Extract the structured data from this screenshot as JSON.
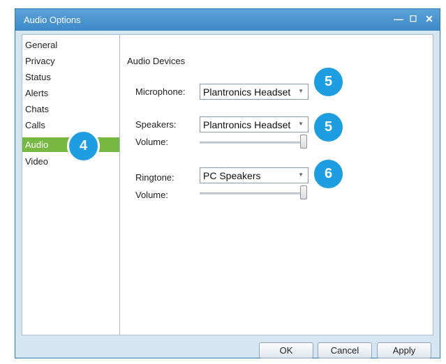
{
  "window": {
    "title": "Audio Options",
    "minimize_glyph": "—",
    "maximize_glyph": "☐",
    "close_glyph": "✕"
  },
  "sidebar": {
    "items": [
      {
        "label": "General"
      },
      {
        "label": "Privacy"
      },
      {
        "label": "Status"
      },
      {
        "label": "Alerts"
      },
      {
        "label": "Chats"
      },
      {
        "label": "Calls"
      },
      {
        "label": "Audio",
        "selected": true
      },
      {
        "label": "Video"
      }
    ]
  },
  "content": {
    "section_title": "Audio Devices",
    "microphone": {
      "label": "Microphone:",
      "value": "Plantronics Headset"
    },
    "speakers": {
      "label": "Speakers:",
      "value": "Plantronics Headset",
      "volume_label": "Volume:",
      "volume_fraction": 1.0
    },
    "ringtone": {
      "label": "Ringtone:",
      "value": "PC Speakers",
      "volume_label": "Volume:",
      "volume_fraction": 1.0
    }
  },
  "badges": [
    {
      "id": "audio-tab",
      "number": "4"
    },
    {
      "id": "microphone",
      "number": "5"
    },
    {
      "id": "speakers",
      "number": "5"
    },
    {
      "id": "ringtone",
      "number": "6"
    }
  ],
  "buttons": {
    "ok": "OK",
    "cancel": "Cancel",
    "apply": "Apply"
  },
  "colors": {
    "titlebar": "#3d88c8",
    "selected_nav": "#77b843",
    "badge": "#1e9ee0",
    "window_bg": "#d5e6f2"
  },
  "icons": {
    "dropdown": "chevron-down-icon"
  }
}
